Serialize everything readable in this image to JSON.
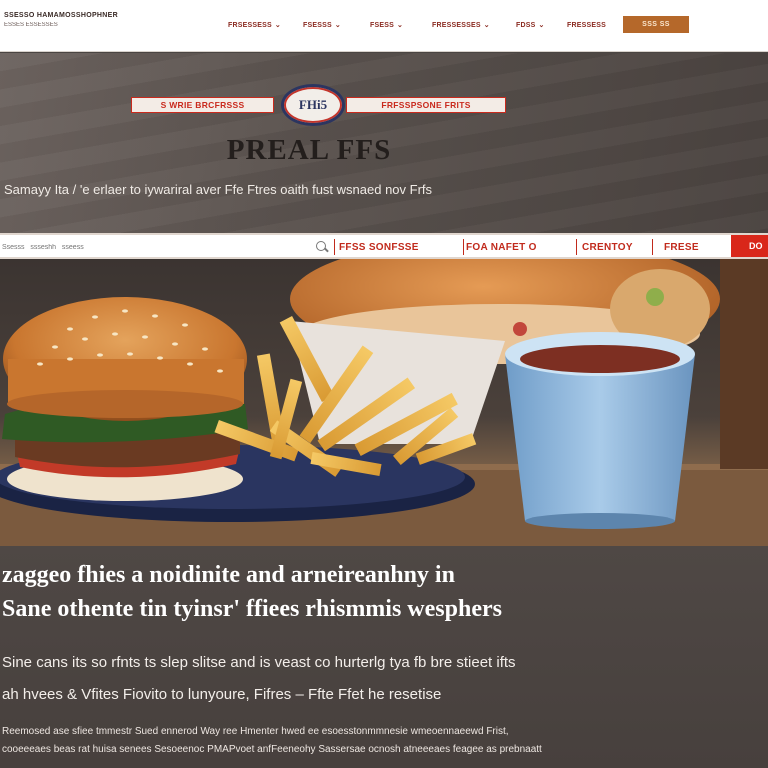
{
  "nav": {
    "brand_name": "SSESSO HAMAMOSSHOPHNER",
    "brand_tagline": "ESSES ESSESSES",
    "items": [
      {
        "label": "FRSESSESS",
        "has_menu": true
      },
      {
        "label": "FSESSS",
        "has_menu": true
      },
      {
        "label": "FSESS",
        "has_menu": true
      },
      {
        "label": "FRESSESSES",
        "has_menu": true
      },
      {
        "label": "FDSS",
        "has_menu": true
      },
      {
        "label": "FRESSESS",
        "has_menu": false
      }
    ],
    "cta_label": "SSS SS"
  },
  "hero": {
    "ribbon_left": "S  WRIE  BRCFRSSS",
    "emblem_text": "FHi5",
    "ribbon_right": "FRFSSPSONE  FRITS",
    "title": "PREAL FFS",
    "subtitle": "Samayy  Ita / 'e erlaer to iywariral aver  Ffe Ftres oaith fust wsnaed nov Frfs"
  },
  "categories": {
    "search_placeholder": "Ssesss   ssseshh   sseess",
    "links": [
      "FFSS SONFSSE",
      "FOA NAFET O",
      "CRENTOY",
      "FRESE"
    ],
    "cta_label": "DO"
  },
  "article": {
    "headline_1": "zaggeo fhies a noidinite and arneireanhny in",
    "headline_2": "Sane othente tin tyinsr' ffiees rhismmis wesphers",
    "body_1": "Sine cans its so rfnts ts slep slitse and is veast co hurterlg tya fb bre stieet ifts",
    "body_2": "ah hvees & Vfites Fiovito to lunyoure, Fifres – Ffte Ffet he resetise",
    "small_1": "   Reemosed ase sfiee tmmestr Sued ennerod Way ree Hmenter hwed ee esoesstonmmnesie wmeoennaeewd Frist,",
    "small_2": "cooeeeaes beas rat huisa senees Sesoeenoc PMAPvoet anfFeeneohy Sassersae ocnosh atneeeaes feagee as prebnaatt"
  },
  "colors": {
    "brand_red": "#d9271a",
    "nav_text": "#8a2a20",
    "cta_orange": "#b5682a",
    "emblem_navy": "#2c3560"
  }
}
